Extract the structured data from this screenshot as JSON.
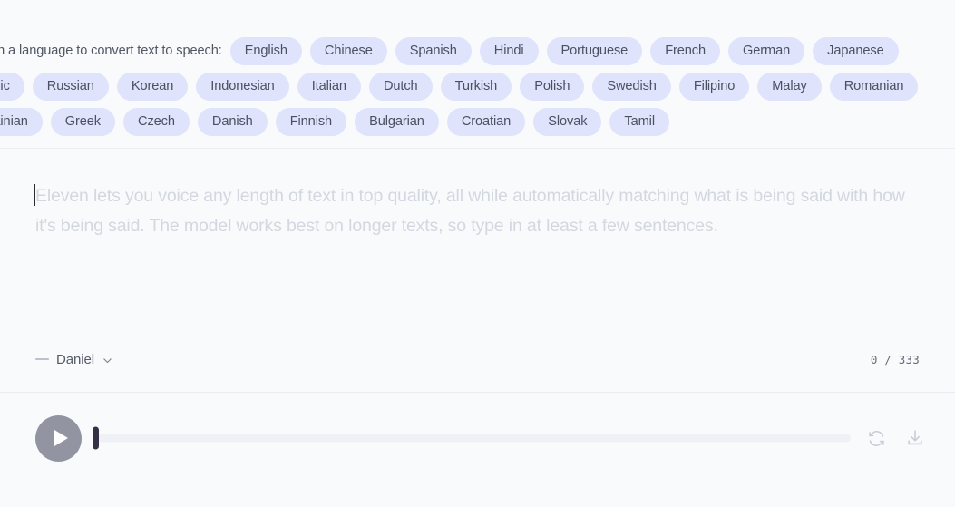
{
  "header": {
    "prompt": "Click on a language to convert text to speech:",
    "languages": [
      "English",
      "Chinese",
      "Spanish",
      "Hindi",
      "Portuguese",
      "French",
      "German",
      "Japanese",
      "Arabic",
      "Russian",
      "Korean",
      "Indonesian",
      "Italian",
      "Dutch",
      "Turkish",
      "Polish",
      "Swedish",
      "Filipino",
      "Malay",
      "Romanian",
      "Ukrainian",
      "Greek",
      "Czech",
      "Danish",
      "Finnish",
      "Bulgarian",
      "Croatian",
      "Slovak",
      "Tamil"
    ]
  },
  "editor": {
    "value": "",
    "placeholder": "Eleven lets you voice any length of text in top quality, all while automatically matching what is being said with how it's being said. The model works best on longer texts, so type in at least a few sentences.",
    "voice": {
      "label": "Daniel",
      "dash_icon": "minus-icon",
      "chevron_icon": "chevron-down-icon"
    },
    "char_count": "0 / 333",
    "char_used": "0",
    "char_limit": "333"
  },
  "player": {
    "play_icon": "play-icon",
    "progress_percent": "0",
    "regenerate_icon": "refresh-icon",
    "download_icon": "download-icon"
  },
  "colors": {
    "page_bg": "#f9fafc",
    "chip_bg": "#dfe3fb",
    "chip_text": "#4a5160",
    "placeholder_text": "#d3d7e0",
    "play_button": "#9295a1",
    "scrub_handle": "#353043",
    "scrub_track": "#eff1f7",
    "icon_muted": "#c7cbd6"
  }
}
